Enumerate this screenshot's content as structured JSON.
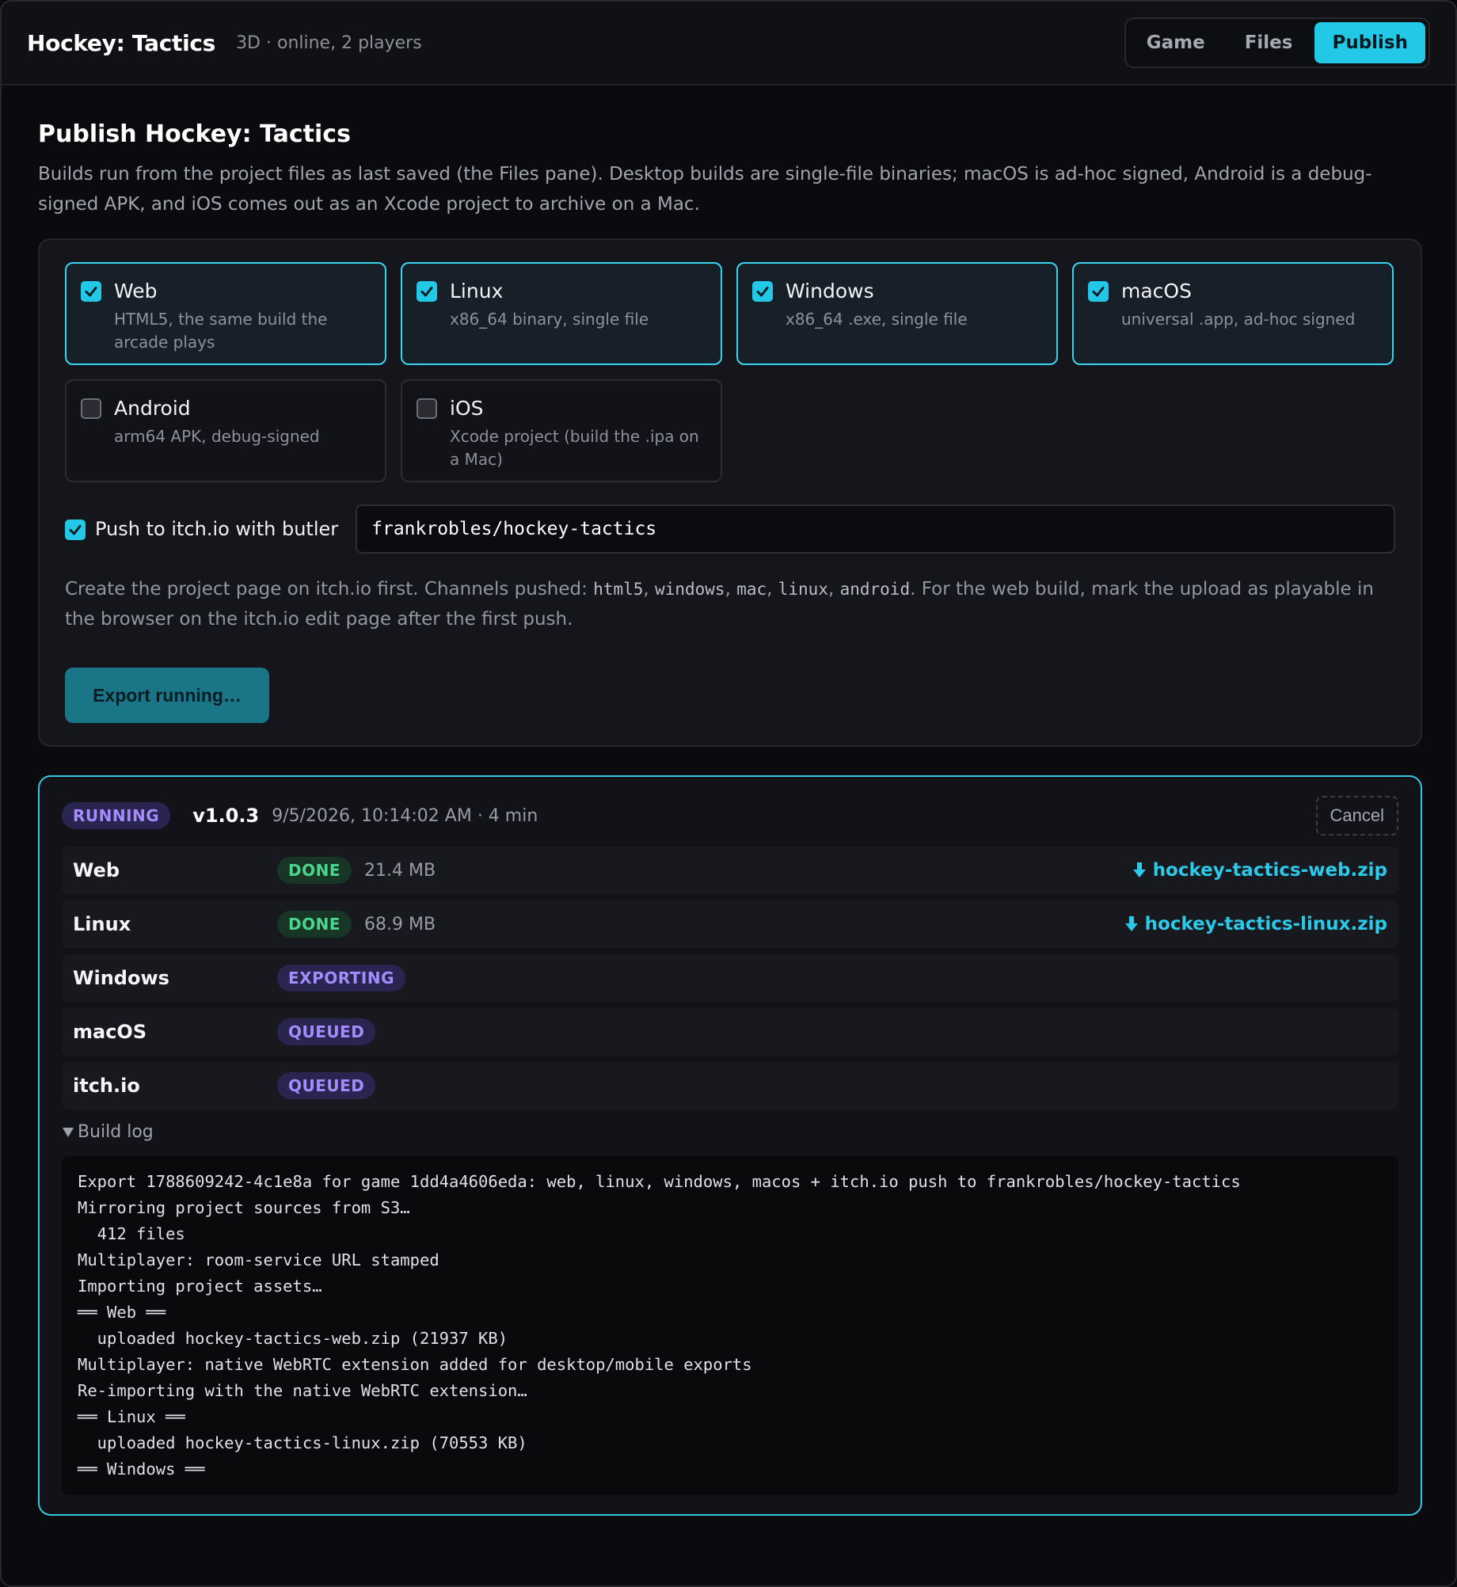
{
  "header": {
    "title": "Hockey: Tactics",
    "subtitle": "3D · online, 2 players",
    "tabs": [
      {
        "label": "Game",
        "active": false
      },
      {
        "label": "Files",
        "active": false
      },
      {
        "label": "Publish",
        "active": true
      }
    ]
  },
  "publish": {
    "heading": "Publish Hockey: Tactics",
    "description": "Builds run from the project files as last saved (the Files pane). Desktop builds are single-file binaries; macOS is ad-hoc signed, Android is a debug-signed APK, and iOS comes out as an Xcode project to archive on a Mac.",
    "targets": [
      {
        "name": "Web",
        "desc": "HTML5, the same build the arcade plays",
        "checked": true
      },
      {
        "name": "Linux",
        "desc": "x86_64 binary, single file",
        "checked": true
      },
      {
        "name": "Windows",
        "desc": "x86_64 .exe, single file",
        "checked": true
      },
      {
        "name": "macOS",
        "desc": "universal .app, ad-hoc signed",
        "checked": true
      },
      {
        "name": "Android",
        "desc": "arm64 APK, debug-signed",
        "checked": false
      },
      {
        "name": "iOS",
        "desc": "Xcode project (build the .ipa on a Mac)",
        "checked": false
      }
    ],
    "push": {
      "label": "Push to itch.io with butler",
      "checked": true,
      "value": "frankrobles/hockey-tactics"
    },
    "note": {
      "before": "Create the project page on itch.io first. Channels pushed: ",
      "channels": [
        "html5",
        "windows",
        "mac",
        "linux",
        "android"
      ],
      "after": ". For the web build, mark the upload as playable in the browser on the itch.io edit page after the first push."
    },
    "export_button": "Export running…"
  },
  "run": {
    "status": "RUNNING",
    "version": "v1.0.3",
    "meta": "9/5/2026, 10:14:02 AM · 4 min",
    "cancel_label": "Cancel",
    "rows": [
      {
        "name": "Web",
        "status": "DONE",
        "size": "21.4 MB",
        "file": "hockey-tactics-web.zip"
      },
      {
        "name": "Linux",
        "status": "DONE",
        "size": "68.9 MB",
        "file": "hockey-tactics-linux.zip"
      },
      {
        "name": "Windows",
        "status": "EXPORTING",
        "size": "",
        "file": ""
      },
      {
        "name": "macOS",
        "status": "QUEUED",
        "size": "",
        "file": ""
      },
      {
        "name": "itch.io",
        "status": "QUEUED",
        "size": "",
        "file": ""
      }
    ],
    "log_toggle": "Build log",
    "log_lines": [
      "Export 1788609242-4c1e8a for game 1dd4a4606eda: web, linux, windows, macos + itch.io push to frankrobles/hockey-tactics",
      "Mirroring project sources from S3…",
      "  412 files",
      "Multiplayer: room-service URL stamped",
      "Importing project assets…",
      "══ Web ══",
      "  uploaded hockey-tactics-web.zip (21937 KB)",
      "Multiplayer: native WebRTC extension added for desktop/mobile exports",
      "Re-importing with the native WebRTC extension…",
      "══ Linux ══",
      "  uploaded hockey-tactics-linux.zip (70553 KB)",
      "══ Windows ══"
    ]
  },
  "colors": {
    "accent": "#22c8e6",
    "done": "#49d68a",
    "purple": "#a48cff"
  }
}
